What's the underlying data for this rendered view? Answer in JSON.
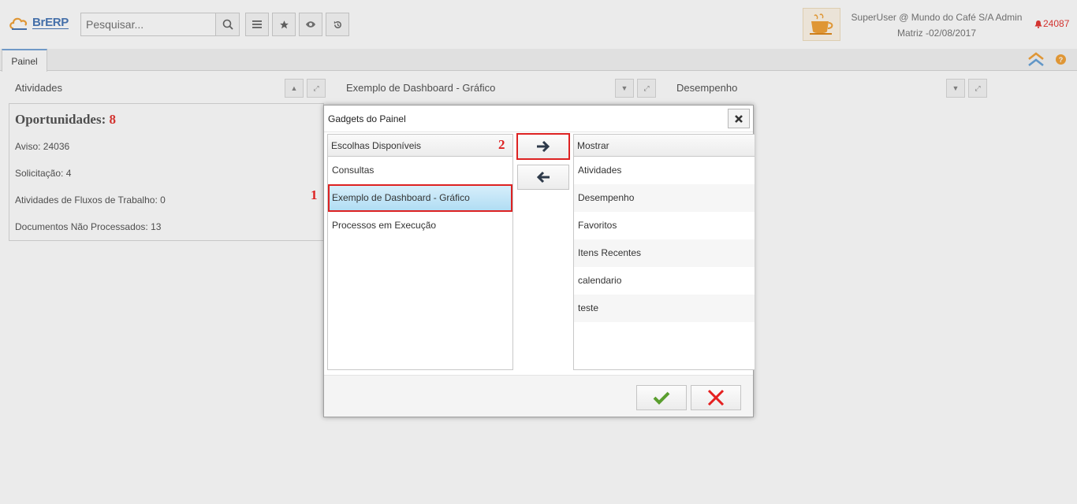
{
  "app": {
    "logo_text": "BrERP",
    "search_placeholder": "Pesquisar...",
    "user_line1": "SuperUser @ Mundo do Café S/A Admin",
    "user_line2": "Matriz -02/08/2017",
    "notification_count": "24087"
  },
  "tabs": [
    {
      "label": "Painel"
    }
  ],
  "dashboard": {
    "panels": [
      {
        "title": "Atividades"
      },
      {
        "title": "Exemplo de Dashboard - Gráfico"
      },
      {
        "title": "Desempenho"
      }
    ],
    "activities": {
      "title": "Oportunidades:",
      "count": "8",
      "lines": [
        "Aviso: 24036",
        "Solicitação: 4",
        "Atividades de Fluxos de Trabalho: 0",
        "Documentos Não Processados: 13"
      ]
    }
  },
  "modal": {
    "title": "Gadgets do Painel",
    "available_header": "Escolhas Disponíveis",
    "available_items": [
      "Consultas",
      "Exemplo de Dashboard - Gráfico",
      "Processos em Execução"
    ],
    "selected_available": "Exemplo de Dashboard - Gráfico",
    "shown_header": "Mostrar",
    "shown_items": [
      "Atividades",
      "Desempenho",
      "Favoritos",
      "Itens Recentes",
      "calendario",
      "teste"
    ],
    "step1": "1",
    "step2": "2"
  },
  "colors": {
    "accent": "#4a79b8",
    "highlight": "#dd2222",
    "ok_green": "#5a9e2f",
    "cancel_red": "#e52020"
  }
}
